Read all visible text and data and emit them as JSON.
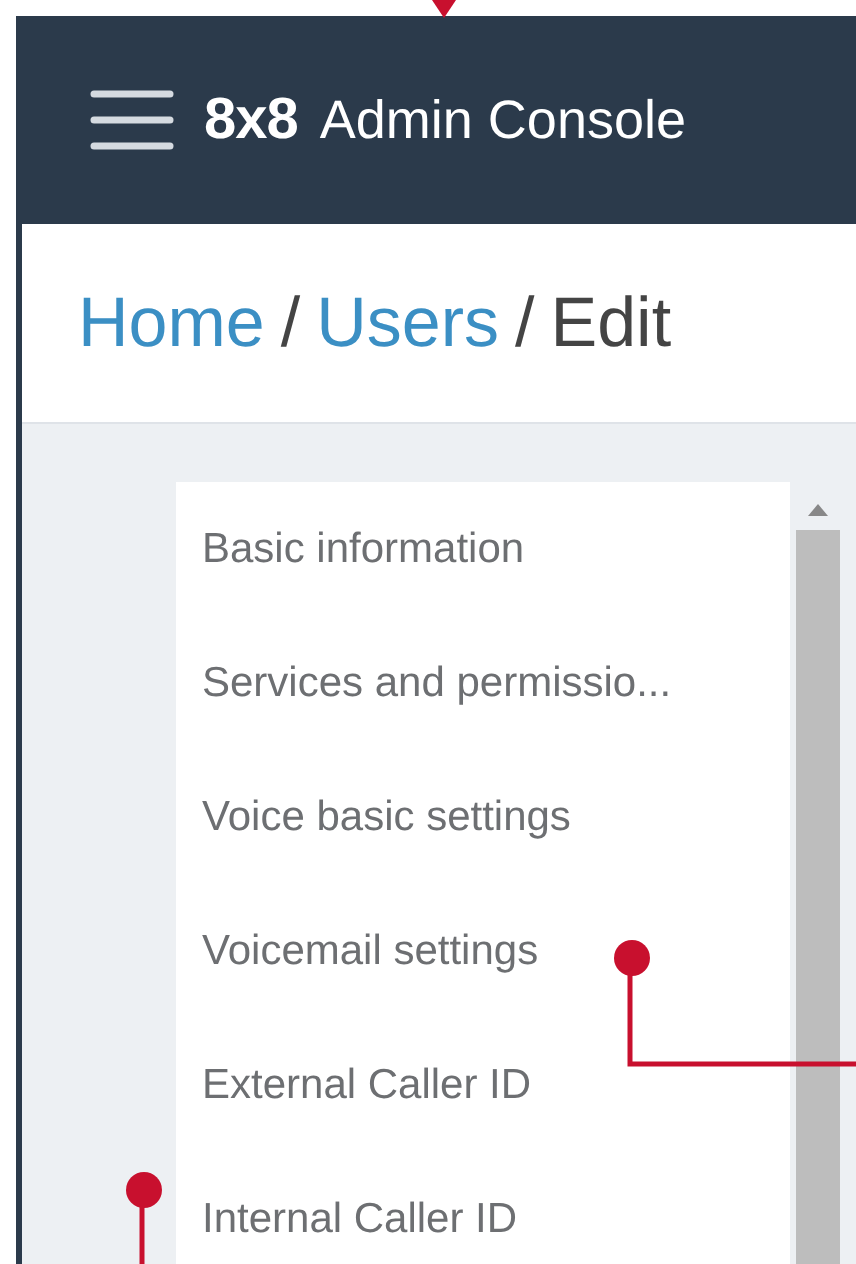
{
  "header": {
    "logo": "8x8",
    "title": "Admin Console"
  },
  "breadcrumb": {
    "separator": "/",
    "items": [
      {
        "label": "Home",
        "kind": "link"
      },
      {
        "label": "Users",
        "kind": "link"
      },
      {
        "label": "Edit",
        "kind": "current"
      }
    ]
  },
  "nav": {
    "items": [
      {
        "label": "Basic information"
      },
      {
        "label": "Services and permissio..."
      },
      {
        "label": "Voice basic settings"
      },
      {
        "label": "Voicemail settings"
      },
      {
        "label": "External Caller ID"
      },
      {
        "label": "Internal Caller ID"
      }
    ]
  }
}
